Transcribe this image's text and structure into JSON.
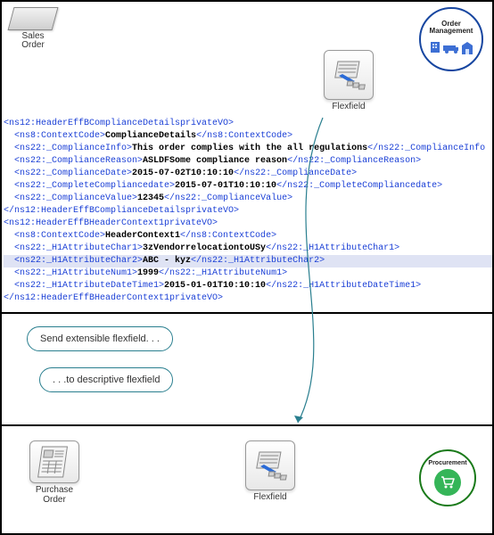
{
  "top": {
    "sales_order_label": "Sales\nOrder",
    "flexfield_label": "Flexfield",
    "order_mgmt_label": "Order\nManagement"
  },
  "xml": {
    "lines": [
      {
        "pre": "<ns12:HeaderEffBComplianceDetailsprivateVO>",
        "txt": "",
        "post": ""
      },
      {
        "pre": "  <ns8:ContextCode>",
        "txt": "ComplianceDetails",
        "post": "</ns8:ContextCode>"
      },
      {
        "pre": "  <ns22:_ComplianceInfo>",
        "txt": "This order complies with the all regulations",
        "post": "</ns22:_ComplianceInfo"
      },
      {
        "pre": "  <ns22:_ComplianceReason>",
        "txt": "ASLDFSome compliance reason",
        "post": "</ns22:_ComplianceReason>"
      },
      {
        "pre": "  <ns22:_ComplianceDate>",
        "txt": "2015-07-02T10:10:10",
        "post": "</ns22:_ComplianceDate>"
      },
      {
        "pre": "  <ns22:_CompleteCompliancedate>",
        "txt": "2015-07-01T10:10:10",
        "post": "</ns22:_CompleteCompliancedate>"
      },
      {
        "pre": "  <ns22:_ComplianceValue>",
        "txt": "12345",
        "post": "</ns22:_ComplianceValue>"
      },
      {
        "pre": "</ns12:HeaderEffBComplianceDetailsprivateVO>",
        "txt": "",
        "post": ""
      },
      {
        "pre": "<ns12:HeaderEffBHeaderContext1privateVO>",
        "txt": "",
        "post": ""
      },
      {
        "pre": "  <ns8:ContextCode>",
        "txt": "HeaderContext1",
        "post": "</ns8:ContextCode>"
      },
      {
        "pre": "  <ns22:_H1AttributeChar1>",
        "txt": "3zVendorrelocationtoUSy",
        "post": "</ns22:_H1AttributeChar1>"
      },
      {
        "pre": "  <ns22:_H1AttributeChar2>",
        "txt": "ABC - kyz",
        "post": "</ns22:_H1AttributeChar2>",
        "hl": true
      },
      {
        "pre": "  <ns22:_H1AttributeNum1>",
        "txt": "1999",
        "post": "</ns22:_H1AttributeNum1>"
      },
      {
        "pre": "  <ns22:_H1AttributeDateTime1>",
        "txt": "2015-01-01T10:10:10",
        "post": "</ns22:_H1AttributeDateTime1>"
      },
      {
        "pre": "</ns12:HeaderEffBHeaderContext1privateVO>",
        "txt": "",
        "post": ""
      }
    ]
  },
  "callouts": {
    "c1": "Send extensible flexfield. . .",
    "c2": ". . .to descriptive flexfield"
  },
  "bottom": {
    "purchase_order_label": "Purchase\nOrder",
    "flexfield_label": "Flexfield",
    "procurement_label": "Procurement"
  }
}
